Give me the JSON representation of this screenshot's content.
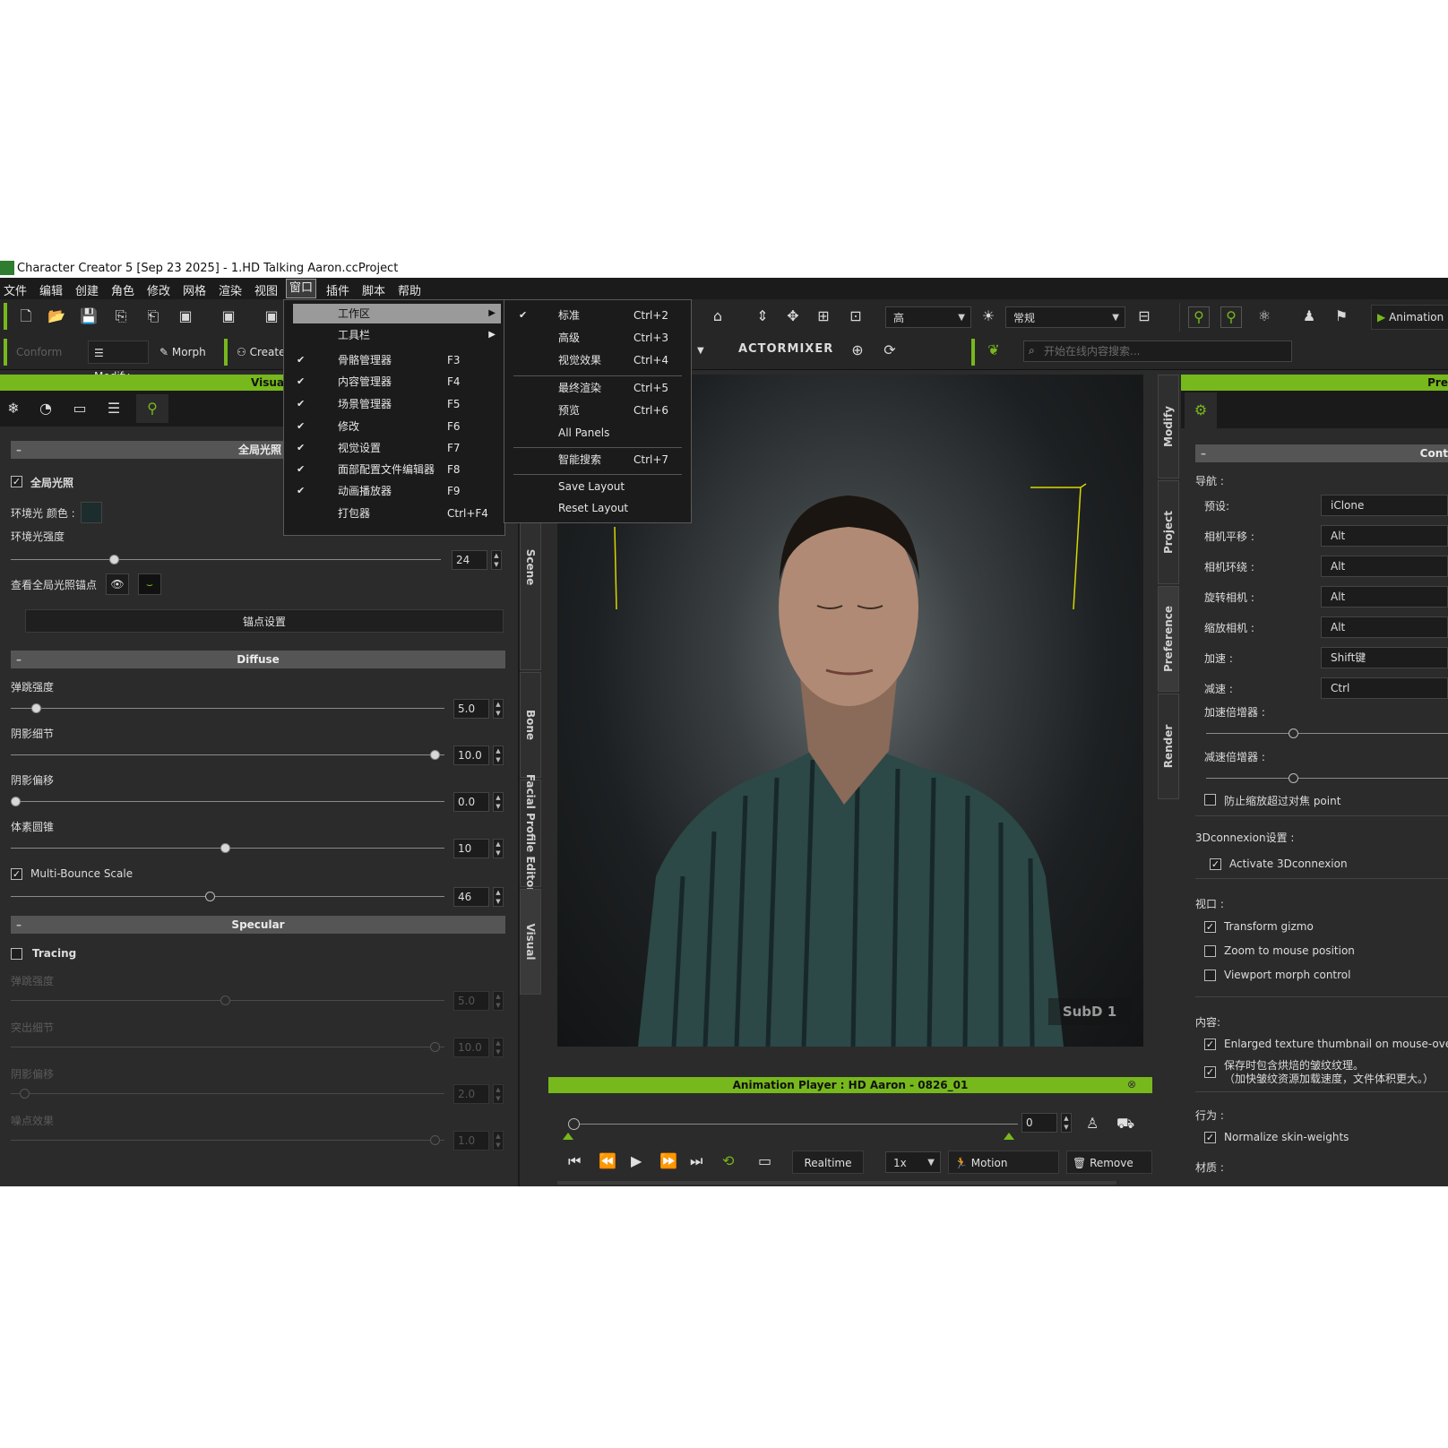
{
  "window": {
    "title": "Character Creator 5 [Sep 23 2025] - 1.HD Talking Aaron.ccProject"
  },
  "menubar": {
    "items": [
      "文件",
      "编辑",
      "创建",
      "角色",
      "修改",
      "网格",
      "渲染",
      "视图",
      "窗口",
      "插件",
      "脚本",
      "帮助"
    ],
    "active": "窗口"
  },
  "toolbar": {
    "conform": "Conform",
    "modify": "Modify",
    "morph": "Morph",
    "create": "Create",
    "quality": "高",
    "mode": "常规",
    "animation": "Animation",
    "actormixer": "ACTORMIXER",
    "search_placeholder": "开始在线内容搜索..."
  },
  "window_menu": {
    "items": [
      {
        "label": "工作区",
        "shortcut": "",
        "checked": false,
        "submenu": true
      },
      {
        "label": "工具栏",
        "shortcut": "",
        "checked": false,
        "submenu": true
      },
      {
        "label": "骨骼管理器",
        "shortcut": "F3",
        "checked": true
      },
      {
        "label": "内容管理器",
        "shortcut": "F4",
        "checked": true
      },
      {
        "label": "场景管理器",
        "shortcut": "F5",
        "checked": true
      },
      {
        "label": "修改",
        "shortcut": "F6",
        "checked": true
      },
      {
        "label": "视觉设置",
        "shortcut": "F7",
        "checked": true
      },
      {
        "label": "面部配置文件编辑器",
        "shortcut": "F8",
        "checked": true
      },
      {
        "label": "动画播放器",
        "shortcut": "F9",
        "checked": true
      },
      {
        "label": "打包器",
        "shortcut": "Ctrl+F4",
        "checked": false
      }
    ]
  },
  "workspace_submenu": {
    "items": [
      {
        "label": "标准",
        "shortcut": "Ctrl+2",
        "checked": true
      },
      {
        "label": "高级",
        "shortcut": "Ctrl+3"
      },
      {
        "label": "视觉效果",
        "shortcut": "Ctrl+4"
      },
      {
        "label": "最终渲染",
        "shortcut": "Ctrl+5"
      },
      {
        "label": "预览",
        "shortcut": "Ctrl+6"
      },
      {
        "label": "All Panels",
        "shortcut": ""
      },
      {
        "label": "智能搜索",
        "shortcut": "Ctrl+7"
      },
      {
        "label": "Save Layout",
        "shortcut": ""
      },
      {
        "label": "Reset Layout",
        "shortcut": ""
      }
    ]
  },
  "left_panel": {
    "header": "Visual",
    "gi_section": "全局光照",
    "gi_checkbox": "全局光照",
    "ambient_color": "环境光 颜色 :",
    "ambient_strength": "环境光强度",
    "ambient_strength_value": "24",
    "view_probe": "查看全局光照锚点",
    "anchor_settings": "锚点设置",
    "diffuse_section": "Diffuse",
    "bounce": "弹跳强度",
    "bounce_value": "5.0",
    "shadow_detail": "阴影细节",
    "shadow_detail_value": "10.0",
    "shadow_offset": "阴影偏移",
    "shadow_offset_value": "0.0",
    "voxel_cone": "体素圆锥",
    "voxel_cone_value": "10",
    "multi_bounce": "Multi-Bounce Scale",
    "multi_bounce_value": "46",
    "specular_section": "Specular",
    "tracing": "Tracing",
    "spec_bounce": "弹跳强度",
    "spec_bounce_value": "5.0",
    "spec_highlight": "突出细节",
    "spec_highlight_value": "10.0",
    "spec_shadow_offset": "阴影偏移",
    "spec_shadow_offset_value": "2.0",
    "spec_noise": "噪点效果",
    "spec_noise_value": "1.0"
  },
  "left_vtabs": [
    "Scene",
    "Bone",
    "Facial Profile Editor",
    "Visual"
  ],
  "right_vtabs": [
    "Modify",
    "Project",
    "Preference",
    "Render"
  ],
  "viewport": {
    "badge": "SubD 1"
  },
  "anim_player": {
    "title": "Animation Player : HD Aaron - 0826_01",
    "frame": "0",
    "realtime": "Realtime",
    "speed": "1x",
    "motion": "Motion",
    "remove": "Remove"
  },
  "right_panel": {
    "header": "Pre",
    "section": "Cont",
    "nav": "导航 :",
    "preset_lbl": "预设:",
    "preset_val": "iClone",
    "pan_lbl": "相机平移 :",
    "pan_val": "Alt",
    "orbit_lbl": "相机环绕 :",
    "orbit_val": "Alt",
    "rotate_lbl": "旋转相机 :",
    "rotate_val": "Alt",
    "zoom_lbl": "缩放相机 :",
    "zoom_val": "Alt",
    "accel_lbl": "加速 :",
    "accel_val": "Shift键",
    "decel_lbl": "减速 :",
    "decel_val": "Ctrl",
    "accel_mult": "加速倍增器 :",
    "decel_mult": "减速倍增器 :",
    "prevent_zoom": "防止缩放超过对焦 point",
    "conn_settings": "3Dconnexion设置 :",
    "activate_3d": "Activate 3Dconnexion",
    "viewport_lbl": "视口 :",
    "transform_gizmo": "Transform gizmo",
    "zoom_mouse": "Zoom to mouse position",
    "viewport_morph": "Viewport morph control",
    "content_lbl": "内容:",
    "enlarged_thumb": "Enlarged texture thumbnail on mouse-over",
    "bake_wrinkle": "保存时包含烘焙的皱纹纹理。",
    "bake_wrinkle2": "（加快皱纹资源加载速度，文件体积更大。）",
    "behavior_lbl": "行为 :",
    "normalize": "Normalize skin-weights",
    "material_lbl": "材质 :"
  },
  "colors": {
    "accent": "#77b81c",
    "panel": "#2b2b2b",
    "menu": "#1b1b1b"
  }
}
